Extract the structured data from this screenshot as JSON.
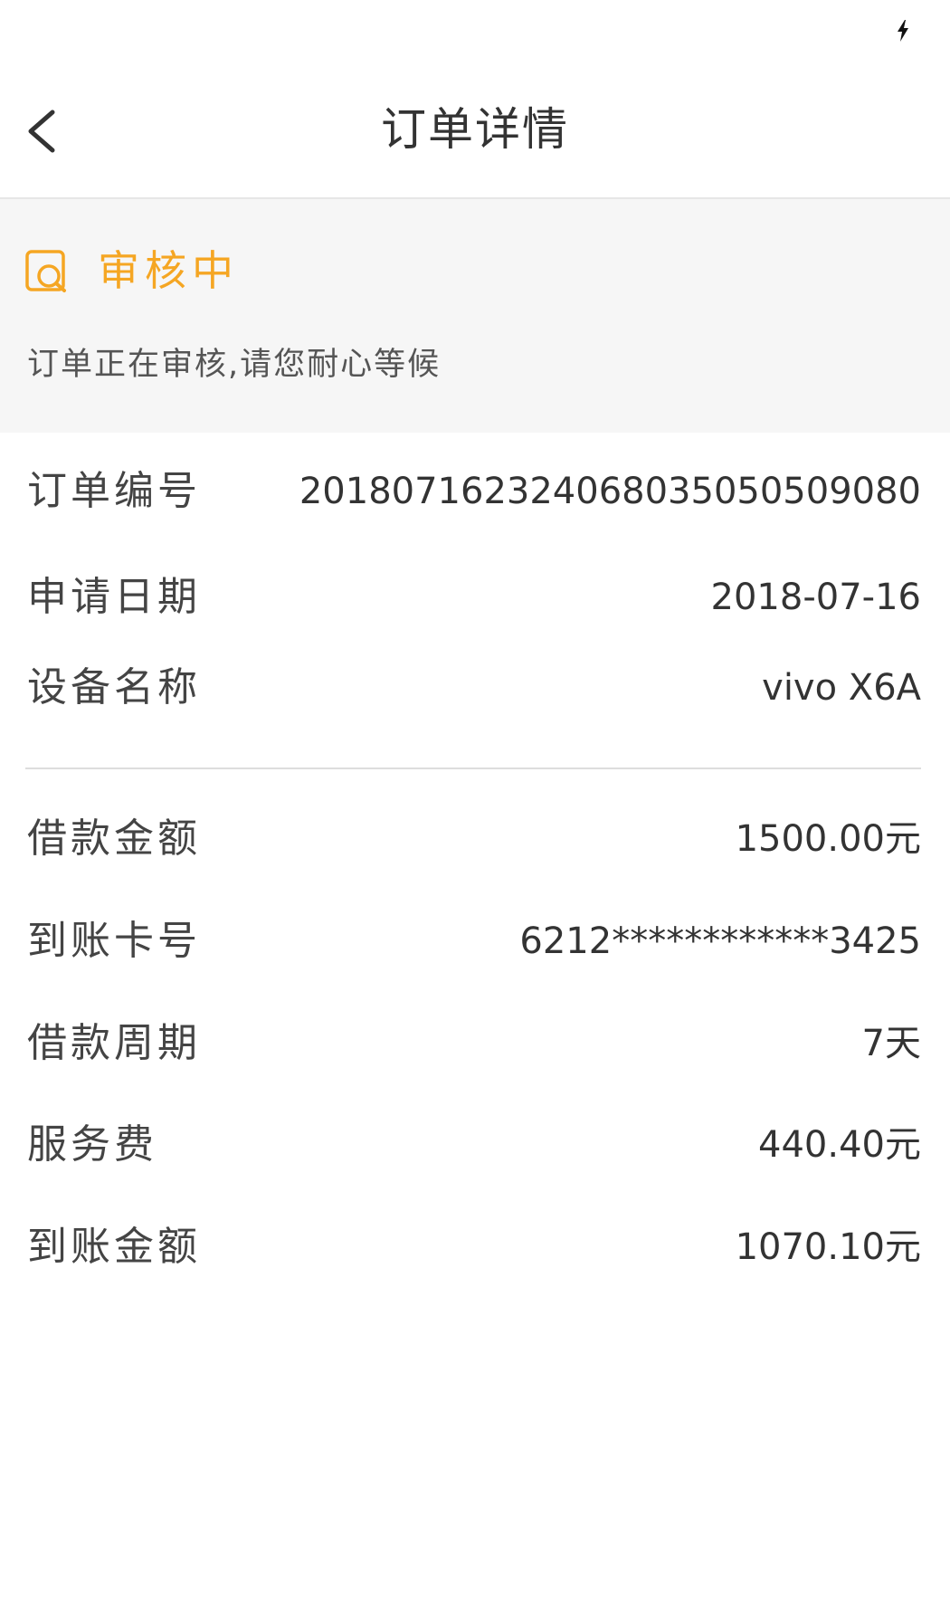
{
  "nav": {
    "title": "订单详情"
  },
  "status": {
    "icon": "review-search-icon",
    "title": "审核中",
    "description": "订单正在审核,请您耐心等候",
    "accent_color": "#f5a623"
  },
  "order_info": [
    {
      "label": "订单编号",
      "value": "2018071623240680350505090​80"
    },
    {
      "label": "申请日期",
      "value": "2018-07-16"
    },
    {
      "label": "设备名称",
      "value": "vivo X6A"
    }
  ],
  "loan_info": [
    {
      "label": "借款金额",
      "value": "1500.00元"
    },
    {
      "label": "到账卡号",
      "value": "6212************3425"
    },
    {
      "label": "借款周期",
      "value": "7天"
    },
    {
      "label": "服务费",
      "value": "440.40元"
    },
    {
      "label": "到账金额",
      "value": "1070.10元"
    }
  ]
}
